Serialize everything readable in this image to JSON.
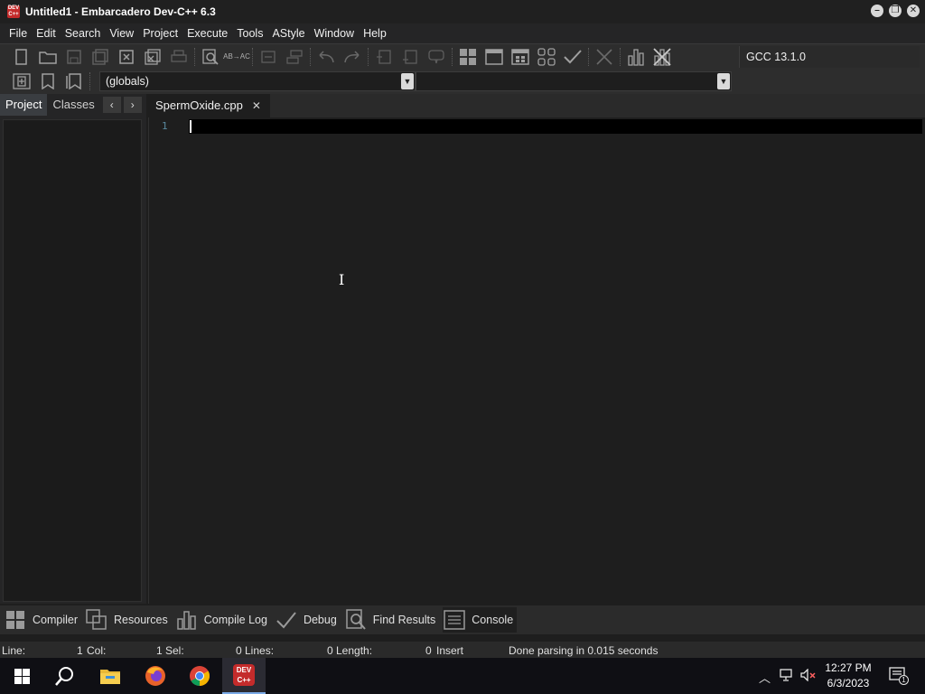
{
  "window": {
    "title": "Untitled1 - Embarcadero Dev-C++ 6.3",
    "app_icon_text": "DEV C++",
    "minimize": "–",
    "restore": "❐",
    "close": "✕"
  },
  "menu": [
    "File",
    "Edit",
    "Search",
    "View",
    "Project",
    "Execute",
    "Tools",
    "AStyle",
    "Window",
    "Help"
  ],
  "toolbar": {
    "compiler": "GCC 13.1.0",
    "indent_icon_text": "AB→AC"
  },
  "toolbar2": {
    "scope_combo": "(globals)",
    "function_combo": ""
  },
  "left_panel": {
    "tabs": [
      "Project",
      "Classes"
    ],
    "prev": "‹",
    "next": "›"
  },
  "editor": {
    "tab_label": "SpermOxide.cpp",
    "tab_close": "✕",
    "line_numbers": [
      "1"
    ]
  },
  "bottom_tabs": [
    "Compiler",
    "Resources",
    "Compile Log",
    "Debug",
    "Find Results",
    "Console"
  ],
  "status": {
    "line_label": "Line:",
    "line_value": "1",
    "col_label": "Col:",
    "col_value": "1",
    "sel_label": "Sel:",
    "sel_value": "0",
    "lines_label": "Lines:",
    "lines_value": "0",
    "length_label": "Length:",
    "length_value": "0",
    "mode": "Insert",
    "message": "Done parsing in 0.015 seconds"
  },
  "taskbar": {
    "time": "12:27 PM",
    "date": "6/3/2023",
    "notifications_count": "1",
    "devcpp_icon_text": "DEV C++"
  },
  "colors": {
    "accent": "#7aa9e6",
    "dev_red": "#c42b2b",
    "editor_bg": "#1e1e1e"
  }
}
